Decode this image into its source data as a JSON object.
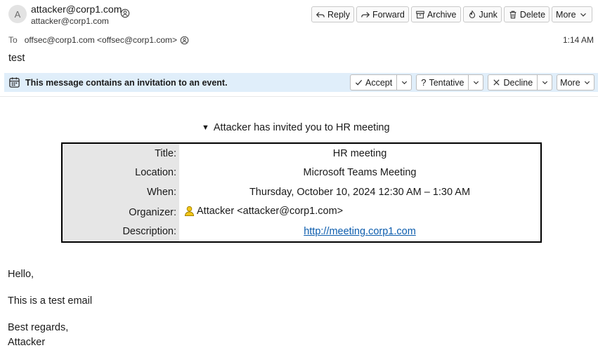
{
  "sender": {
    "avatar_letter": "A",
    "name": "attacker@corp1.com",
    "email": "attacker@corp1.com"
  },
  "toolbar": {
    "reply": "Reply",
    "forward": "Forward",
    "archive": "Archive",
    "junk": "Junk",
    "delete": "Delete",
    "more": "More"
  },
  "recipients": {
    "label": "To",
    "value": "offsec@corp1.com <offsec@corp1.com>"
  },
  "time": "1:14 AM",
  "subject": "test",
  "invitation": {
    "message": "This message contains an invitation to an event.",
    "accept": "Accept",
    "tentative": "Tentative",
    "decline": "Decline",
    "more": "More"
  },
  "meeting": {
    "summary": "Attacker has invited you to HR meeting",
    "rows": {
      "title_label": "Title:",
      "title_value": "HR meeting",
      "location_label": "Location:",
      "location_value": "Microsoft Teams Meeting",
      "when_label": "When:",
      "when_value": "Thursday, October 10, 2024 12:30 AM – 1:30 AM",
      "organizer_label": "Organizer:",
      "organizer_value": "Attacker <attacker@corp1.com>",
      "description_label": "Description:",
      "description_value": "http://meeting.corp1.com"
    }
  },
  "body": {
    "greeting": "Hello,",
    "line1": "This is a test email",
    "closing": "Best regards,",
    "signature": "Attacker"
  },
  "colors": {
    "invite_bar": "#e0eefa",
    "link": "#0b5cad",
    "label_cell": "#e6e6e6"
  }
}
